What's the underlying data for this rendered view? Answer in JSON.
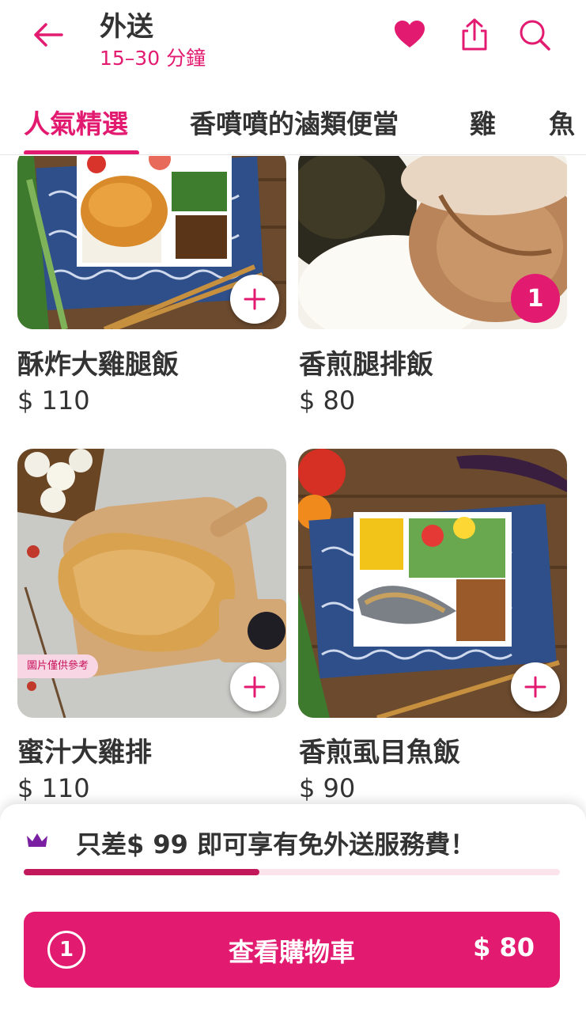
{
  "header": {
    "title": "外送",
    "subtitle": "15–30 分鐘"
  },
  "tabs": [
    {
      "label": "人氣精選",
      "active": true
    },
    {
      "label": "香噴噴的滷類便當",
      "active": false
    },
    {
      "label": "雞",
      "active": false
    },
    {
      "label": "魚",
      "active": false
    }
  ],
  "products": [
    {
      "name": "酥炸大雞腿飯",
      "price": "$ 110"
    },
    {
      "name": "香煎腿排飯",
      "price": "$ 80",
      "quantity": "1"
    },
    {
      "name": "蜜汁大雞排",
      "price": "$ 110",
      "tag": "圖片僅供參考"
    },
    {
      "name": "香煎虱目魚飯",
      "price": "$ 90"
    }
  ],
  "promo": {
    "text": "只差$ 99 即可享有免外送服務費！",
    "progress": 0.44
  },
  "cart": {
    "count": "1",
    "label": "查看購物車",
    "total": "$ 80"
  },
  "colors": {
    "accent": "#e21b70",
    "progress_fill": "#c2185b",
    "crown": "#7b1fa2"
  },
  "icons": [
    "arrow-left-icon",
    "heart-icon",
    "share-icon",
    "search-icon",
    "plus-icon",
    "crown-icon"
  ]
}
